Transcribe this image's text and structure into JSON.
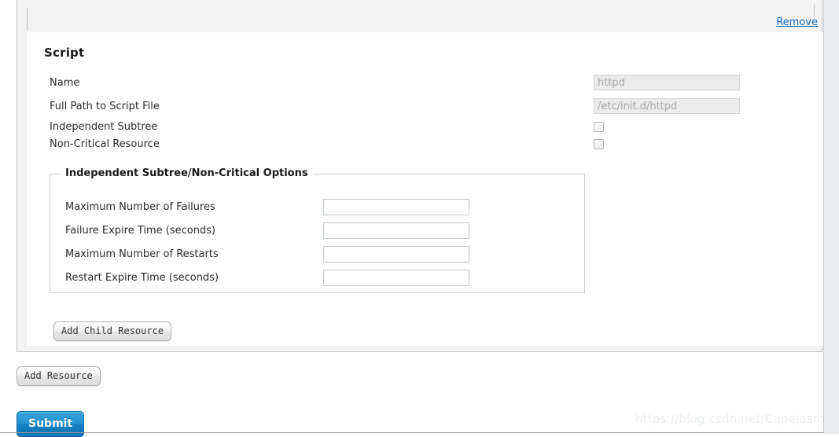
{
  "panel": {
    "remove_link": "Remove",
    "heading": "Script",
    "fields": [
      {
        "label": "Name",
        "type": "text",
        "value": "httpd"
      },
      {
        "label": "Full Path to Script File",
        "type": "text",
        "value": "/etc/init.d/httpd"
      },
      {
        "label": "Independent Subtree",
        "type": "checkbox",
        "checked": false
      },
      {
        "label": "Non-Critical Resource",
        "type": "checkbox",
        "checked": false
      }
    ],
    "options_fieldset": {
      "legend": "Independent Subtree/Non-Critical Options",
      "fields": [
        {
          "label": "Maximum Number of Failures",
          "value": ""
        },
        {
          "label": "Failure Expire Time (seconds)",
          "value": ""
        },
        {
          "label": "Maximum Number of Restarts",
          "value": ""
        },
        {
          "label": "Restart Expire Time (seconds)",
          "value": ""
        }
      ]
    },
    "add_child_resource_label": "Add Child Resource"
  },
  "actions": {
    "add_resource_label": "Add Resource",
    "submit_label": "Submit"
  },
  "watermark": "https://blog.csdn.net/CapejasmineY",
  "colors": {
    "link": "#1569b0",
    "submit_blue": "#1583c4",
    "panel_gray": "#f3f3f3",
    "rail_gray": "#e8ecef",
    "disabled_input_bg": "#ebebeb"
  }
}
